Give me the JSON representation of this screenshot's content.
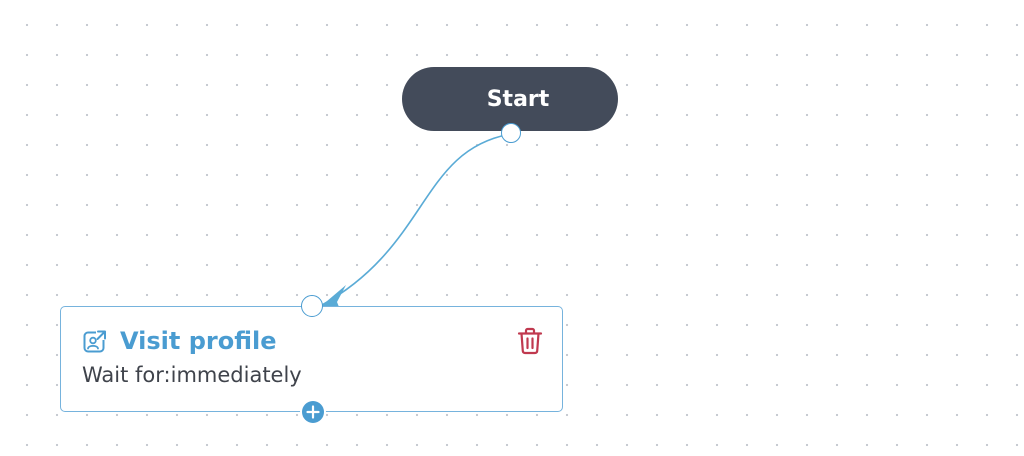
{
  "colors": {
    "start_node_bg": "#434b5a",
    "accent": "#4a9cd1",
    "edge": "#5aabd6",
    "delete": "#c0394f",
    "text": "#3f434b"
  },
  "flow": {
    "start_node": {
      "label": "Start"
    },
    "steps": [
      {
        "icon": "visit-profile-icon",
        "title": "Visit profile",
        "subtitle": "Wait for:immediately",
        "delete_icon": "trash-icon",
        "add_icon": "plus-icon"
      }
    ]
  }
}
